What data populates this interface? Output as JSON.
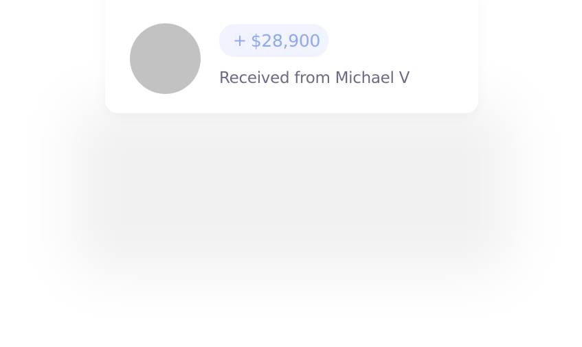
{
  "transaction": {
    "amount_sign": "+",
    "amount": "$28,900",
    "description": "Received from Michael V"
  },
  "colors": {
    "amount_text": "#8ea8f3",
    "amount_badge_bg": "#f1f4ff",
    "description_text": "#6c6b86",
    "avatar_placeholder": "#c2c2c2"
  }
}
